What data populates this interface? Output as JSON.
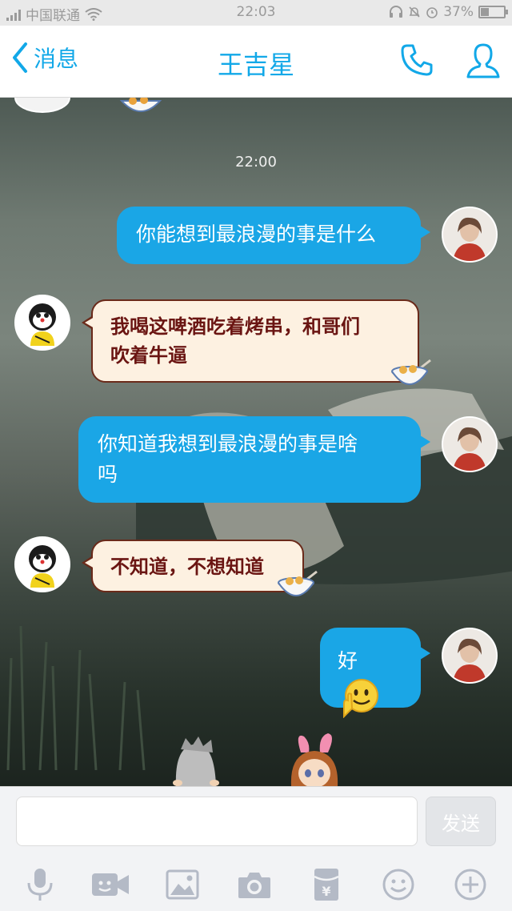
{
  "status_bar": {
    "carrier": "中国联通",
    "time": "22:03",
    "battery": "37%",
    "battery_level": 0.37
  },
  "header": {
    "back_label": "消息",
    "title": "王吉星",
    "icons": [
      "phone-icon",
      "profile-icon"
    ]
  },
  "chat": {
    "timestamp": "22:00",
    "messages": [
      {
        "side": "right",
        "text": "你能想到最浪漫的事是什么"
      },
      {
        "side": "left",
        "line1": "我喝这啤酒吃着烤串，和哥们",
        "line2": "吹着牛逼"
      },
      {
        "side": "right",
        "line1": "你知道我想到最浪漫的事是啥",
        "line2": "吗"
      },
      {
        "side": "left",
        "text": "不知道，不想知道"
      },
      {
        "side": "right",
        "text": "好"
      }
    ]
  },
  "input_bar": {
    "placeholder": "",
    "send_label": "发送",
    "tools": [
      "microphone-icon",
      "video-call-icon",
      "image-icon",
      "camera-icon",
      "red-packet-icon",
      "emoji-icon",
      "add-icon"
    ]
  },
  "colors": {
    "accent": "#12a8e8",
    "bubble_right": "#1aa6e6",
    "bubble_left": "#fdf1e1",
    "bubble_left_text": "#6a1512"
  }
}
